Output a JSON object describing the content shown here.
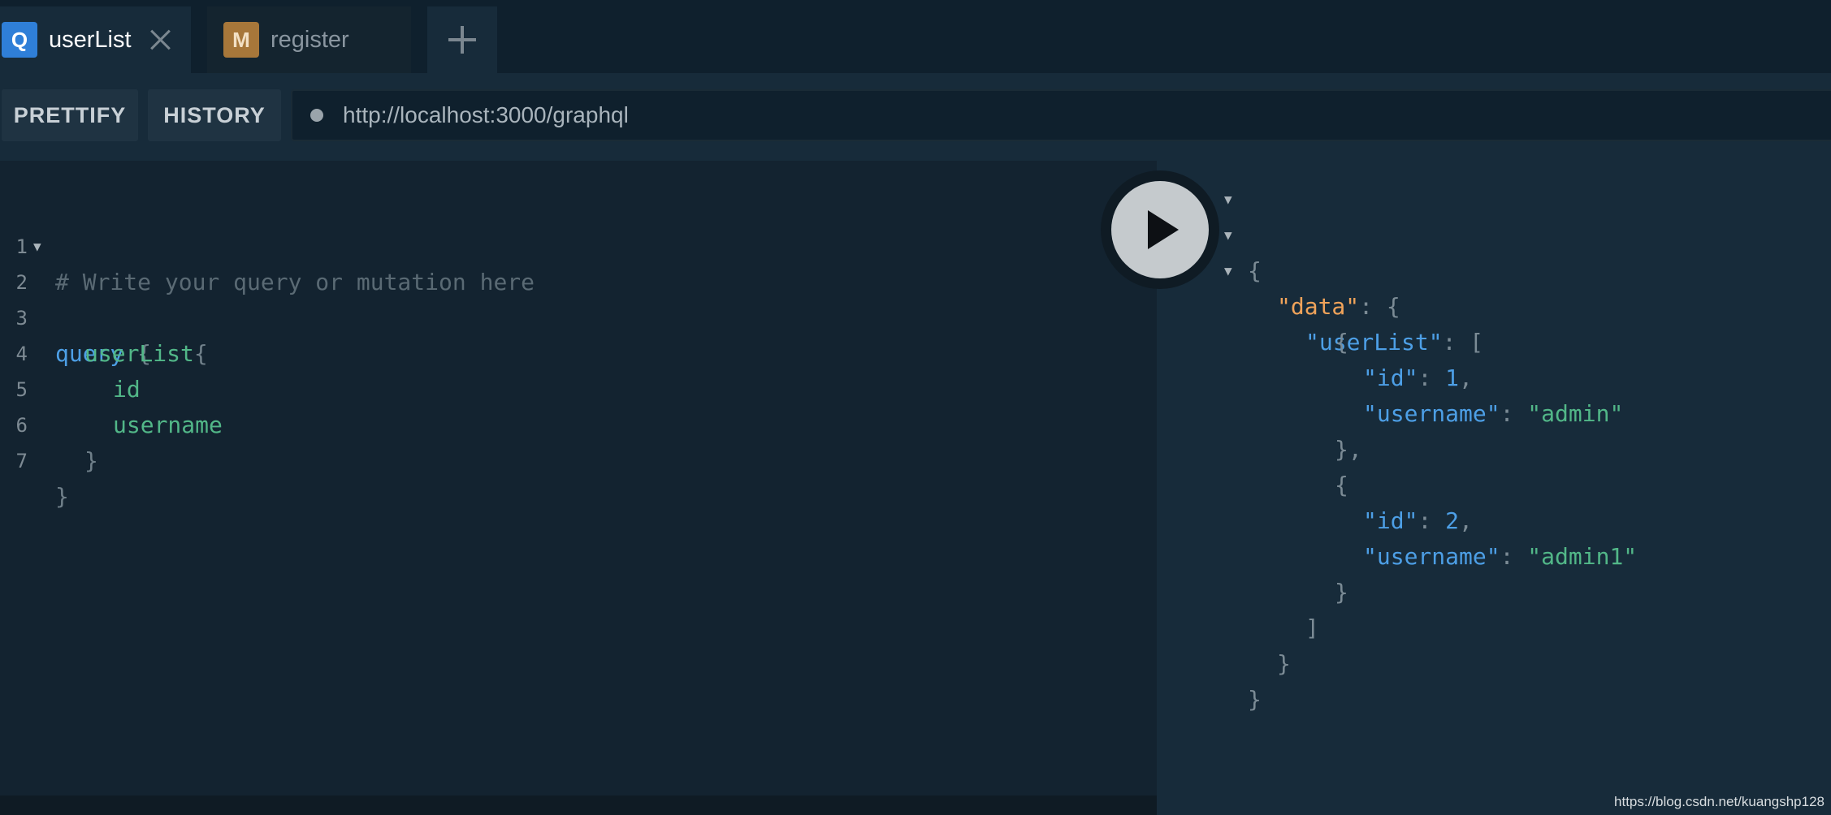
{
  "tabs": [
    {
      "badge": "Q",
      "title": "userList",
      "active": true
    },
    {
      "badge": "M",
      "title": "register",
      "active": false
    }
  ],
  "toolbar": {
    "prettify_label": "PRETTIFY",
    "history_label": "HISTORY",
    "endpoint_url": "http://localhost:3000/graphql"
  },
  "editor": {
    "lines": [
      {
        "num": "1",
        "comment": "# Write your query or mutation here"
      },
      {
        "num": "2",
        "keyword": "query",
        "punct": " {"
      },
      {
        "num": "3",
        "field": "userList",
        "punct": "{"
      },
      {
        "num": "4",
        "field": "id"
      },
      {
        "num": "5",
        "field": "username"
      },
      {
        "num": "6",
        "punct": "}"
      },
      {
        "num": "7",
        "punct": "}"
      }
    ]
  },
  "result": {
    "open_brace": "{",
    "data_key": "\"data\"",
    "userlist_key": "\"userList\"",
    "items": [
      {
        "id_key": "\"id\"",
        "id_value": "1",
        "username_key": "\"username\"",
        "username_value": "\"admin\""
      },
      {
        "id_key": "\"id\"",
        "id_value": "2",
        "username_key": "\"username\"",
        "username_value": "\"admin1\""
      }
    ]
  },
  "watermark": "https://blog.csdn.net/kuangshp128"
}
